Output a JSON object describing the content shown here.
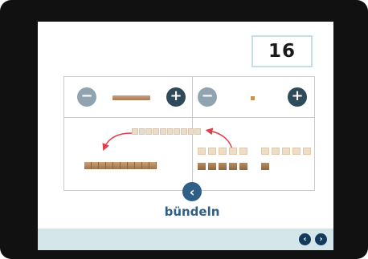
{
  "display": {
    "number": "16"
  },
  "tens_control": {
    "minus_icon": "minus-circle-icon",
    "plus_icon": "plus-circle-icon"
  },
  "ones_control": {
    "minus_icon": "minus-circle-icon",
    "plus_icon": "plus-circle-icon"
  },
  "workspace": {
    "ten_rods": 1,
    "unit_cubes_light": 10,
    "unit_cubes_dark": 6
  },
  "bundle": {
    "label": "bündeln",
    "icon": "chevron-left-icon"
  },
  "footer": {
    "prev_icon": "chevron-left-icon",
    "next_icon": "chevron-right-icon"
  },
  "colors": {
    "accent": "#2f5f86",
    "footer_bg": "#d4e6ea",
    "arrow": "#e0404c"
  }
}
